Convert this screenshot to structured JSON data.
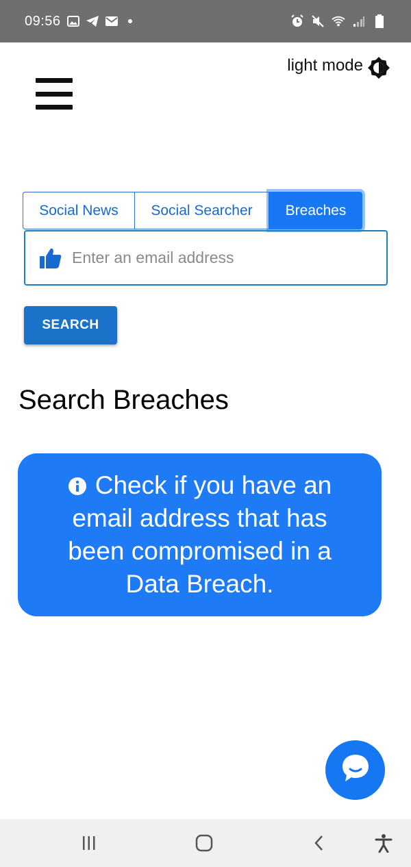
{
  "status_bar": {
    "time": "09:56",
    "icons_left": [
      "image-icon",
      "telegram-icon",
      "mail-icon",
      "dot-icon"
    ],
    "icons_right": [
      "alarm-icon",
      "mute-icon",
      "wifi-icon",
      "signal-icon",
      "battery-icon"
    ]
  },
  "header": {
    "mode_label": "light mode",
    "mode_icon": "brightness-icon",
    "menu_icon": "hamburger-menu-icon"
  },
  "tabs": [
    {
      "label": "Social News",
      "active": false
    },
    {
      "label": "Social Searcher",
      "active": false
    },
    {
      "label": "Breaches",
      "active": true
    }
  ],
  "search": {
    "placeholder": "Enter an email address",
    "value": "",
    "icon": "thumbs-up-icon",
    "button_label": "SEARCH"
  },
  "main": {
    "title": "Search Breaches",
    "info_text": "Check if you have an email address that has been compromised in a Data Breach.",
    "info_icon": "info-icon"
  },
  "chat": {
    "icon": "chat-icon"
  },
  "nav_bar": {
    "icons": [
      "recents-icon",
      "home-icon",
      "back-icon",
      "accessibility-icon"
    ]
  },
  "colors": {
    "accent": "#1877f2",
    "input_border": "#1a7fc2",
    "button": "#1a73c8",
    "info_bg": "#1f7af5",
    "status_bar": "#6f6f6f",
    "nav_bar": "#f0f0f0"
  }
}
